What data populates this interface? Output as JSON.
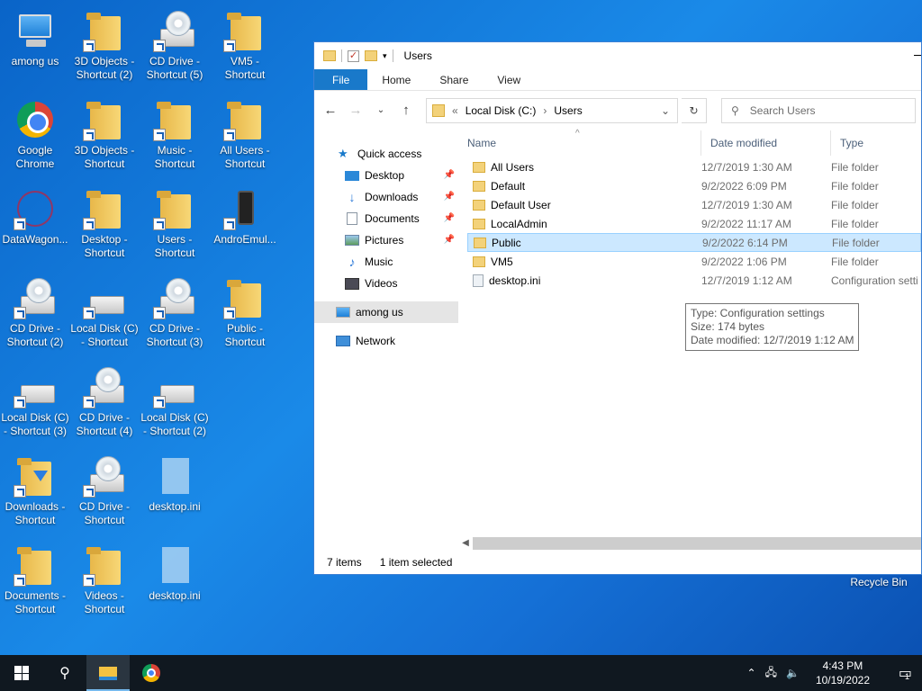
{
  "desktop": {
    "icons": [
      {
        "label": "among us"
      },
      {
        "label": "3D Objects - Shortcut (2)"
      },
      {
        "label": "CD Drive - Shortcut (5)"
      },
      {
        "label": "VM5 - Shortcut"
      },
      {
        "label": "Google Chrome"
      },
      {
        "label": "3D Objects - Shortcut"
      },
      {
        "label": "Music - Shortcut"
      },
      {
        "label": "All Users - Shortcut"
      },
      {
        "label": "DataWagon..."
      },
      {
        "label": "Desktop - Shortcut"
      },
      {
        "label": "Users - Shortcut"
      },
      {
        "label": "AndroEmul..."
      },
      {
        "label": "CD Drive - Shortcut (2)"
      },
      {
        "label": "Local Disk (C) - Shortcut"
      },
      {
        "label": "CD Drive - Shortcut (3)"
      },
      {
        "label": "Public - Shortcut"
      },
      {
        "label": "Local Disk (C) - Shortcut (3)"
      },
      {
        "label": "CD Drive - Shortcut (4)"
      },
      {
        "label": "Local Disk (C) - Shortcut (2)"
      },
      {
        "label": "Downloads - Shortcut"
      },
      {
        "label": "CD Drive - Shortcut"
      },
      {
        "label": "desktop.ini"
      },
      {
        "label": "Documents - Shortcut"
      },
      {
        "label": "Videos - Shortcut"
      },
      {
        "label": "desktop.ini"
      }
    ],
    "recycle_bin": "Recycle Bin"
  },
  "explorer": {
    "title": "Users",
    "ribbon_tabs": [
      "File",
      "Home",
      "Share",
      "View"
    ],
    "address": {
      "prefix": "«",
      "segments": [
        "Local Disk (C:)",
        "Users"
      ]
    },
    "search_placeholder": "Search Users",
    "nav": {
      "quick_access": "Quick access",
      "items": [
        "Desktop",
        "Downloads",
        "Documents",
        "Pictures",
        "Music",
        "Videos"
      ],
      "among_us": "among us",
      "network": "Network"
    },
    "columns": [
      "Name",
      "Date modified",
      "Type"
    ],
    "files": [
      {
        "name": "All Users",
        "date": "12/7/2019 1:30 AM",
        "type": "File folder"
      },
      {
        "name": "Default",
        "date": "9/2/2022 6:09 PM",
        "type": "File folder"
      },
      {
        "name": "Default User",
        "date": "12/7/2019 1:30 AM",
        "type": "File folder"
      },
      {
        "name": "LocalAdmin",
        "date": "9/2/2022 11:17 AM",
        "type": "File folder"
      },
      {
        "name": "Public",
        "date": "9/2/2022 6:14 PM",
        "type": "File folder"
      },
      {
        "name": "VM5",
        "date": "9/2/2022 1:06 PM",
        "type": "File folder"
      },
      {
        "name": "desktop.ini",
        "date": "12/7/2019 1:12 AM",
        "type": "Configuration setti"
      }
    ],
    "selected_index": 4,
    "tooltip": {
      "line1": "Type: Configuration settings",
      "line2": "Size: 174 bytes",
      "line3": "Date modified: 12/7/2019 1:12 AM"
    },
    "status": {
      "count": "7 items",
      "selection": "1 item selected"
    }
  },
  "taskbar": {
    "time": "4:43 PM",
    "date": "10/19/2022",
    "notifications": "1"
  },
  "colors": {
    "accent": "#1979ca",
    "selection": "#cce8ff",
    "taskbar": "#101820"
  }
}
